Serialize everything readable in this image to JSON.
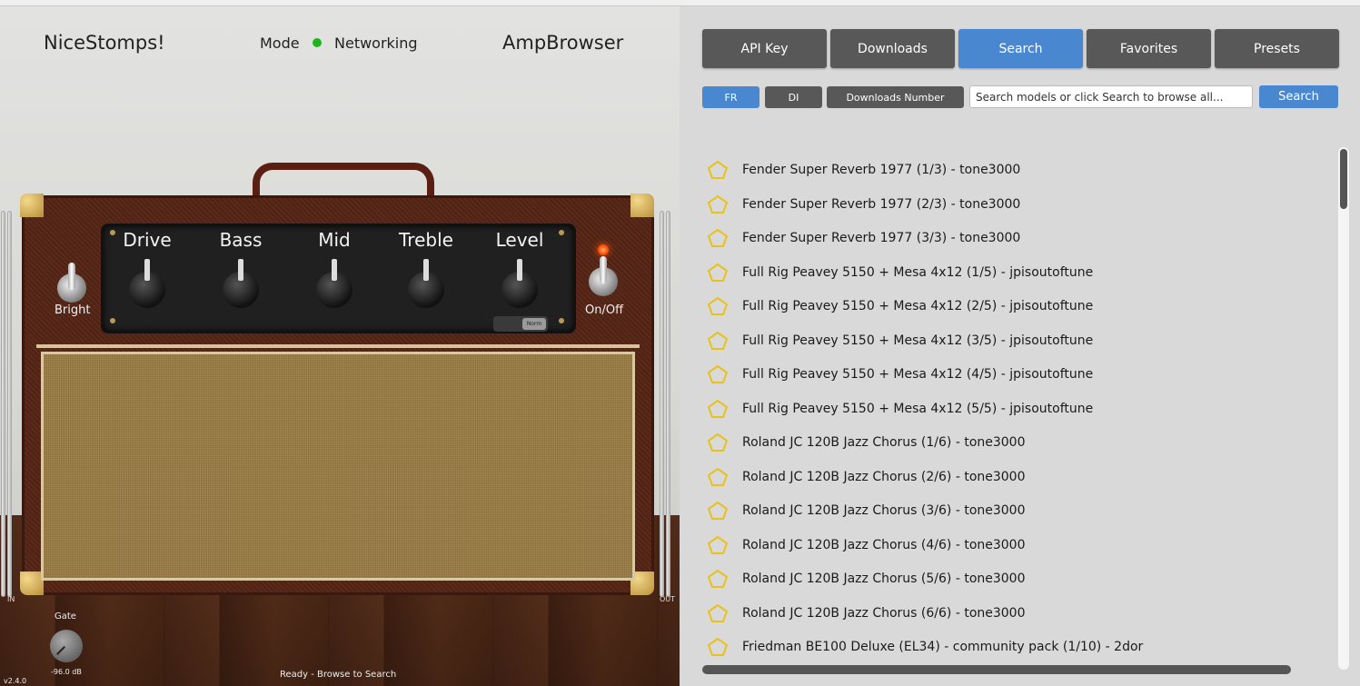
{
  "header": {
    "brand": "NiceStomps!",
    "mode_label": "Mode",
    "mode_status": "Networking",
    "app_name": "AmpBrowser"
  },
  "amp": {
    "knobs": [
      "Drive",
      "Bass",
      "Mid",
      "Treble",
      "Level"
    ],
    "bright_label": "Bright",
    "power_label": "On/Off",
    "norm_label": "Norm"
  },
  "meters": {
    "in_label": "IN",
    "out_label": "OUT"
  },
  "gate": {
    "label": "Gate",
    "value": "-96.0 dB"
  },
  "footer": {
    "version": "v2.4.0",
    "status": "Ready - Browse to Search"
  },
  "tabs": [
    "API Key",
    "Downloads",
    "Search",
    "Favorites",
    "Presets"
  ],
  "active_tab": "Search",
  "filters": {
    "fr": "FR",
    "di": "DI",
    "downloads_number": "Downloads Number",
    "search_placeholder": "Search models or click Search to browse all...",
    "search_button": "Search"
  },
  "colors": {
    "accent": "#4a87d1",
    "tab": "#585858",
    "star": "#e8c21a",
    "mode_dot": "#1db51d",
    "led": "#ff4a00"
  },
  "results": [
    "Fender Super Reverb 1977 (1/3) - tone3000",
    "Fender Super Reverb 1977 (2/3) - tone3000",
    "Fender Super Reverb 1977 (3/3) - tone3000",
    "Full Rig Peavey 5150 + Mesa 4x12 (1/5) - jpisoutoftune",
    "Full Rig Peavey 5150 + Mesa 4x12 (2/5) - jpisoutoftune",
    "Full Rig Peavey 5150 + Mesa 4x12 (3/5) - jpisoutoftune",
    "Full Rig Peavey 5150 + Mesa 4x12 (4/5) - jpisoutoftune",
    "Full Rig Peavey 5150 + Mesa 4x12 (5/5) - jpisoutoftune",
    "Roland JC 120B Jazz Chorus (1/6) - tone3000",
    "Roland JC 120B Jazz Chorus (2/6) - tone3000",
    "Roland JC 120B Jazz Chorus (3/6) - tone3000",
    "Roland JC 120B Jazz Chorus (4/6) - tone3000",
    "Roland JC 120B Jazz Chorus (5/6) - tone3000",
    "Roland JC 120B Jazz Chorus (6/6) - tone3000",
    "Friedman BE100 Deluxe (EL34) - community pack (1/10) - 2dor"
  ]
}
